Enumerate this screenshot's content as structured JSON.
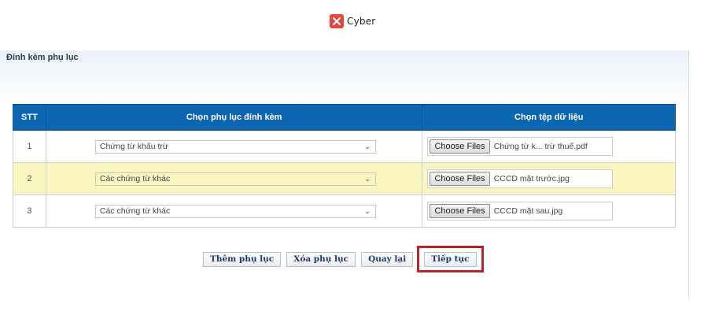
{
  "brand": {
    "name": "Cyber",
    "logo_icon": "x-mark-icon",
    "logo_color": "#e8453c"
  },
  "panel": {
    "title": "Đính kèm phụ lục"
  },
  "table": {
    "headers": {
      "stt": "STT",
      "appendix": "Chọn phụ lục đính kèm",
      "file": "Chọn tệp dữ liệu"
    },
    "header_color": "#0f66b0",
    "highlight_row_color": "#fbf6c0",
    "rows": [
      {
        "stt": "1",
        "appendix": "Chứng từ khấu trừ",
        "choose_label": "Choose Files",
        "file_name": "Chứng từ k... trừ thuế.pdf"
      },
      {
        "stt": "2",
        "appendix": "Các chứng từ khác",
        "choose_label": "Choose Files",
        "file_name": "CCCD mặt trước.jpg"
      },
      {
        "stt": "3",
        "appendix": "Các chứng từ khác",
        "choose_label": "Choose Files",
        "file_name": "CCCD mặt sau.jpg"
      }
    ]
  },
  "actions": {
    "add": "Thêm phụ lục",
    "delete": "Xóa phụ lục",
    "back": "Quay lại",
    "continue": "Tiếp tục",
    "highlight_color": "#b3262b"
  }
}
